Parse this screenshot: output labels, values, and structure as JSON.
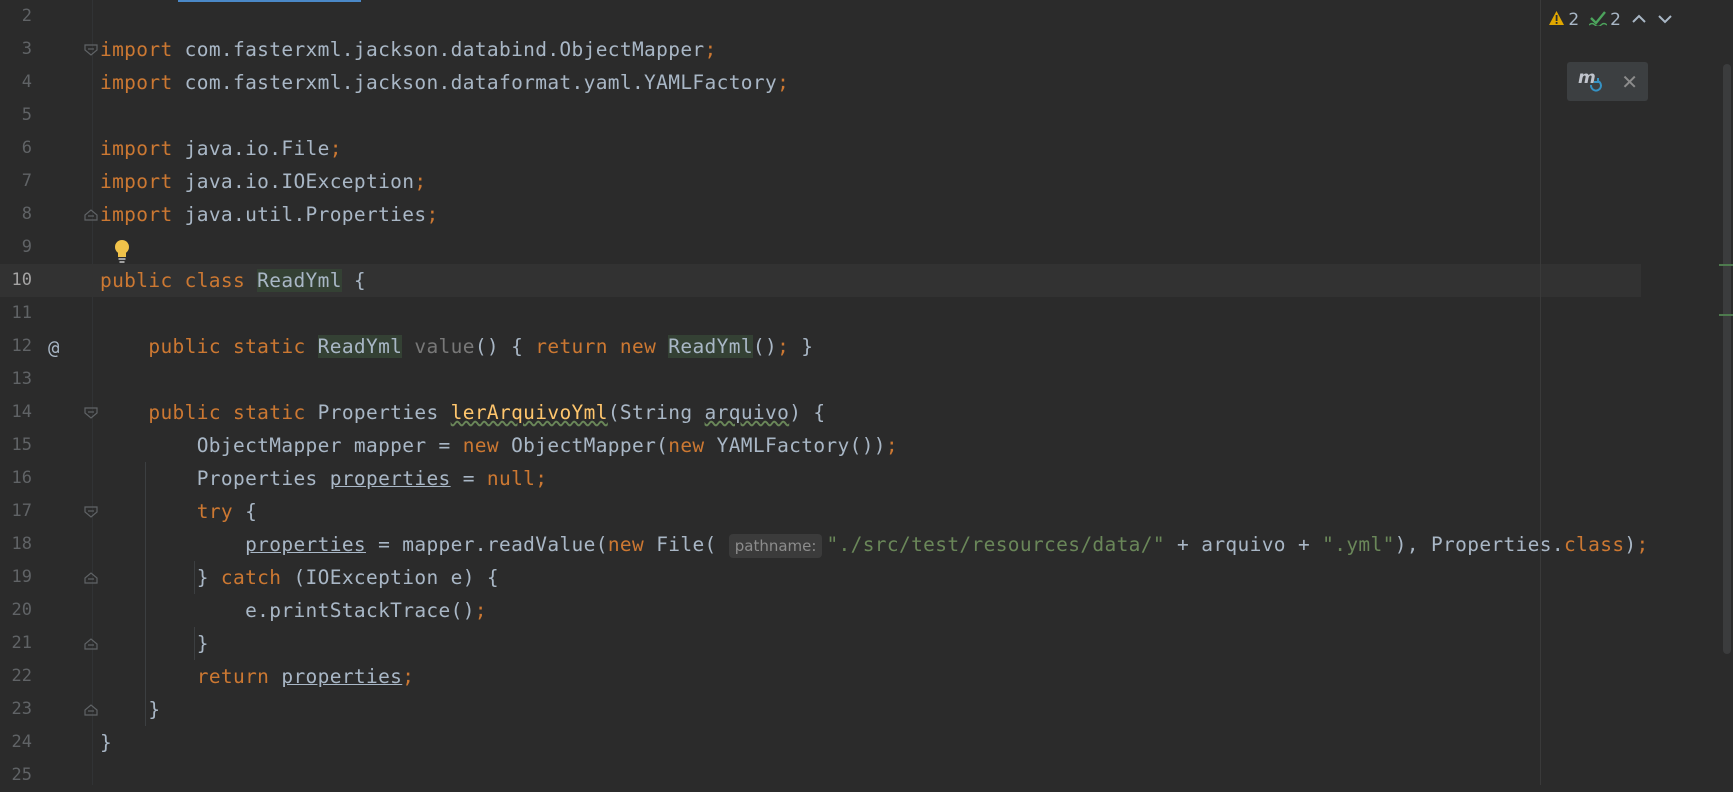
{
  "editor": {
    "current_line": "10",
    "lines": [
      {
        "num": "2",
        "parts": []
      },
      {
        "num": "3",
        "parts": [
          [
            "kw",
            "import "
          ],
          [
            "",
            "com.fasterxml.jackson.databind.ObjectMapper"
          ],
          [
            "kw",
            ";"
          ]
        ]
      },
      {
        "num": "4",
        "parts": [
          [
            "kw",
            "import "
          ],
          [
            "",
            "com.fasterxml.jackson.dataformat.yaml.YAMLFactory"
          ],
          [
            "kw",
            ";"
          ]
        ]
      },
      {
        "num": "5",
        "parts": []
      },
      {
        "num": "6",
        "parts": [
          [
            "kw",
            "import "
          ],
          [
            "",
            "java.io.File"
          ],
          [
            "kw",
            ";"
          ]
        ]
      },
      {
        "num": "7",
        "parts": [
          [
            "kw",
            "import "
          ],
          [
            "",
            "java.io.IOException"
          ],
          [
            "kw",
            ";"
          ]
        ]
      },
      {
        "num": "8",
        "parts": [
          [
            "kw",
            "import "
          ],
          [
            "",
            "java.util.Properties"
          ],
          [
            "kw",
            ";"
          ]
        ]
      },
      {
        "num": "9",
        "parts": []
      },
      {
        "num": "10",
        "parts": [
          [
            "kw",
            "public class "
          ],
          [
            "hl",
            "ReadYml"
          ],
          [
            "",
            " {"
          ]
        ]
      },
      {
        "num": "11",
        "parts": []
      },
      {
        "num": "12",
        "parts": [
          [
            "",
            "    "
          ],
          [
            "kw",
            "public static "
          ],
          [
            "hl",
            "ReadYml"
          ],
          [
            "",
            " "
          ],
          [
            "unused",
            "value"
          ],
          [
            "",
            "() { "
          ],
          [
            "kw",
            "return new "
          ],
          [
            "hl",
            "ReadYml"
          ],
          [
            "",
            "()"
          ],
          [
            "kw",
            ";"
          ],
          [
            "",
            " }"
          ]
        ]
      },
      {
        "num": "13",
        "parts": []
      },
      {
        "num": "14",
        "parts": [
          [
            "",
            "    "
          ],
          [
            "kw",
            "public static "
          ],
          [
            "",
            "Properties "
          ],
          [
            "fnw",
            "lerArquivoYml"
          ],
          [
            "",
            "(String "
          ],
          [
            "wavy",
            "arquivo"
          ],
          [
            "",
            ") {"
          ]
        ]
      },
      {
        "num": "15",
        "parts": [
          [
            "",
            "        ObjectMapper mapper = "
          ],
          [
            "kw",
            "new "
          ],
          [
            "",
            "ObjectMapper("
          ],
          [
            "kw",
            "new "
          ],
          [
            "",
            "YAMLFactory())"
          ],
          [
            "kw",
            ";"
          ]
        ]
      },
      {
        "num": "16",
        "parts": [
          [
            "",
            "        Properties "
          ],
          [
            "ul",
            "properties"
          ],
          [
            "",
            " = "
          ],
          [
            "kw",
            "null;"
          ]
        ]
      },
      {
        "num": "17",
        "parts": [
          [
            "",
            "        "
          ],
          [
            "kw",
            "try "
          ],
          [
            "",
            "{"
          ]
        ]
      },
      {
        "num": "18",
        "parts": [
          [
            "",
            "            "
          ],
          [
            "ul",
            "properties"
          ],
          [
            "",
            " = mapper.readValue("
          ],
          [
            "kw",
            "new "
          ],
          [
            "",
            "File( "
          ],
          [
            "hint",
            "pathname:"
          ],
          [
            "str",
            "\"./src/test/resources/data/\""
          ],
          [
            "",
            " + arquivo + "
          ],
          [
            "str",
            "\".yml\""
          ],
          [
            "",
            "), Properties."
          ],
          [
            "kw",
            "class"
          ],
          [
            "",
            ")"
          ],
          [
            "kw",
            ";"
          ]
        ]
      },
      {
        "num": "19",
        "parts": [
          [
            "",
            "        } "
          ],
          [
            "kw",
            "catch "
          ],
          [
            "",
            "(IOException e) {"
          ]
        ]
      },
      {
        "num": "20",
        "parts": [
          [
            "",
            "            e.printStackTrace()"
          ],
          [
            "kw",
            ";"
          ]
        ]
      },
      {
        "num": "21",
        "parts": [
          [
            "",
            "        }"
          ]
        ]
      },
      {
        "num": "22",
        "parts": [
          [
            "",
            "        "
          ],
          [
            "kw",
            "return "
          ],
          [
            "ul",
            "properties"
          ],
          [
            "kw",
            ";"
          ]
        ]
      },
      {
        "num": "23",
        "parts": [
          [
            "",
            "    }"
          ]
        ]
      },
      {
        "num": "24",
        "parts": [
          [
            "",
            "}"
          ]
        ]
      },
      {
        "num": "25",
        "parts": []
      }
    ]
  },
  "gutter": {
    "override_marker": "@"
  },
  "inspections": {
    "warnings": "2",
    "typos": "2"
  },
  "colors": {
    "background": "#2b2b2b",
    "keyword": "#cc7832",
    "string": "#6a8759",
    "function": "#ffc66d",
    "text": "#a9b7c6",
    "warning": "#e0a700",
    "typo": "#4ca35c"
  },
  "icons": {
    "warning": "warning-icon",
    "typo": "typo-check-icon",
    "up": "chevron-up-icon",
    "down": "chevron-down-icon",
    "maven": "maven-reload-icon",
    "close": "close-icon",
    "bulb": "lightbulb-icon"
  }
}
